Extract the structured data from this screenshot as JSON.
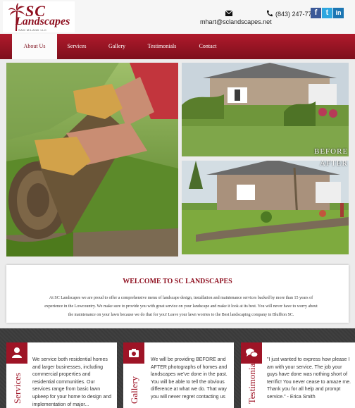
{
  "header": {
    "logo_sc": "SC",
    "logo_landscapes": "Landscapes",
    "logo_llc": "SAM MILAND LLC",
    "email": "mhart@sclandscapes.net",
    "phone": "(843) 247-7785",
    "social": [
      {
        "icon": "facebook-icon",
        "glyph": "f",
        "color": "#3b5998"
      },
      {
        "icon": "twitter-icon",
        "glyph": "t",
        "color": "#2ea7e0"
      },
      {
        "icon": "linkedin-icon",
        "glyph": "in",
        "color": "#1c76b3"
      }
    ]
  },
  "nav": {
    "items": [
      {
        "label": "About Us",
        "active": true
      },
      {
        "label": "Services",
        "active": false
      },
      {
        "label": "Gallery",
        "active": false
      },
      {
        "label": "Testimonials",
        "active": false
      },
      {
        "label": "Contact",
        "active": false
      }
    ]
  },
  "gallery": {
    "before_label": "BEFORE",
    "after_label": "AFTER"
  },
  "welcome": {
    "title": "WELCOME TO SC LANDSCAPES",
    "body": "At SC Landscapes we are proud to offer a comprehensive menu of landscape design, installation and maintenance services backed by more than 15 years of experience in the Lowcountry. We make sure to provide you with great service on your landscape and make it look at its best.  You will never have to worry about the maintenance on your lawn because we do that for you!  Leave your lawn worries to the Best landscaping company in Bluffton SC."
  },
  "cards": [
    {
      "heading": "Services",
      "icon": "user-icon",
      "text": "We service both residential homes and larger businesses, including commercial properties and residential communities. Our services range from basic lawn upkeep for your home to design and implementation of major..."
    },
    {
      "heading": "Gallery",
      "icon": "camera-icon",
      "text": "We will be providing BEFORE and AFTER photographs of homes and landscapes we've done in the past. You will be able to tell the obvious difference at what we do. That way you will never regret contacting us"
    },
    {
      "heading": "Testimonials",
      "icon": "chat-bubbles-icon",
      "text": "\"I just wanted to express how please I am with your service. The job your guys have done was nothing short of terrific! You never cease to amaze me. Thank you for all help and prompt service.\"  - Erica Smith"
    }
  ],
  "colors": {
    "brand_red": "#8e0f1f",
    "nav_top": "#b01a2c",
    "nav_bottom": "#7e0f1c",
    "dark_section": "#3a3a3a"
  }
}
